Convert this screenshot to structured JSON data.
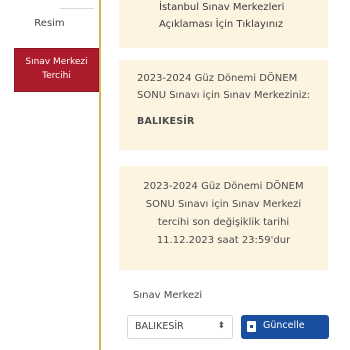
{
  "sidebar": {
    "resim_label": "Resim",
    "active_item": {
      "line1": "Sınav Merkezi",
      "line2": "Tercihi"
    }
  },
  "links": {
    "line1": "İstanbul Sınav Merkezleri",
    "line2": "Açıklaması İçin Tıklayınız"
  },
  "info": {
    "line1": "2023-2024 Güz Dönemi DÖNEM",
    "line2": "SONU Sınavı için Sınav Merkeziniz:",
    "city": "BALIKESİR"
  },
  "deadline": {
    "line1": "2023-2024 Güz Dönemi DÖNEM",
    "line2": "SONU Sınavı için Sınav Merkezi",
    "line3": "tercihi son değişiklik tarihi",
    "line4": "11.12.2023 saat 23:59'dur"
  },
  "form": {
    "label": "Sınav Merkezi",
    "selected": "BALIKESİR",
    "button_label": "Güncelle"
  },
  "colors": {
    "accent_red": "#ad1c2c",
    "panel_bg": "#fdf3e1",
    "border_gold": "#d9b25c",
    "button_blue": "#1a4e9e"
  }
}
